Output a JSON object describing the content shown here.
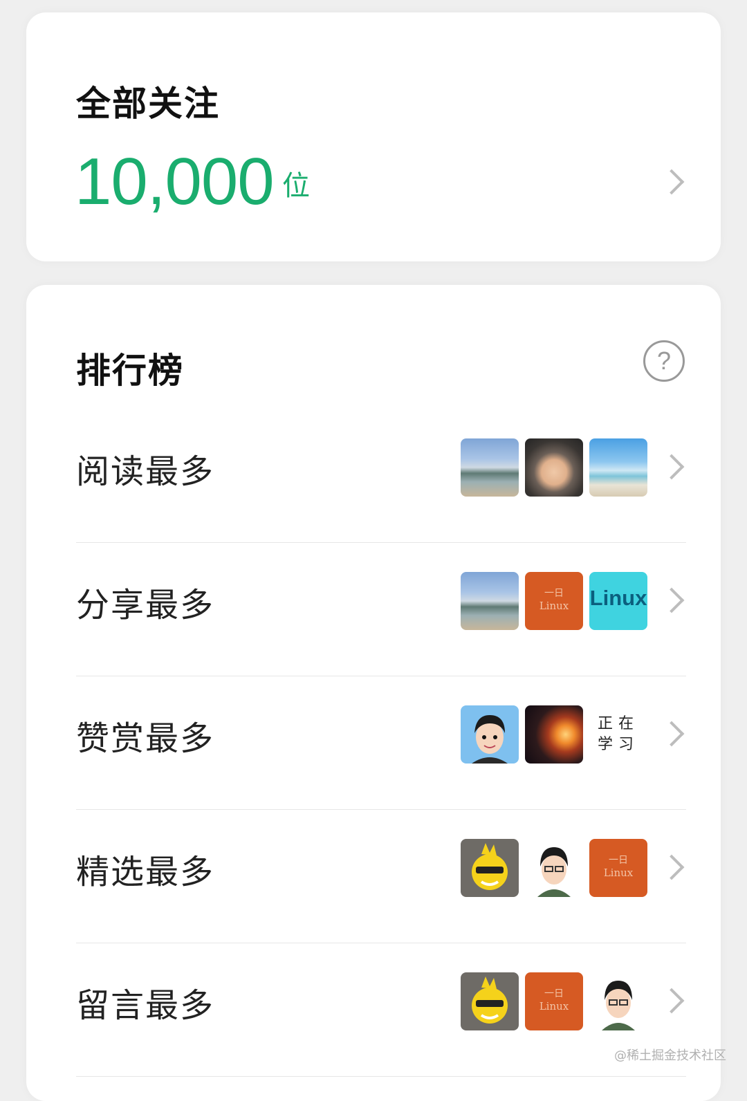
{
  "follow": {
    "title": "全部关注",
    "count": "10,000",
    "unit": "位"
  },
  "ranking": {
    "title": "排行榜",
    "help_icon": "question-circle-icon",
    "rows": [
      {
        "label": "阅读最多"
      },
      {
        "label": "分享最多"
      },
      {
        "label": "赞赏最多"
      },
      {
        "label": "精选最多"
      },
      {
        "label": "留言最多"
      }
    ],
    "avatar_texts": {
      "linux_brand": "Linux",
      "linux_orange_top": "一日",
      "linux_orange_bottom": "Linux",
      "studying_line1": "正在",
      "studying_line2": "学习"
    }
  },
  "watermark": "@稀土掘金技术社区",
  "colors": {
    "accent_green": "#1aad6e",
    "background": "#efefef",
    "card": "#ffffff"
  }
}
